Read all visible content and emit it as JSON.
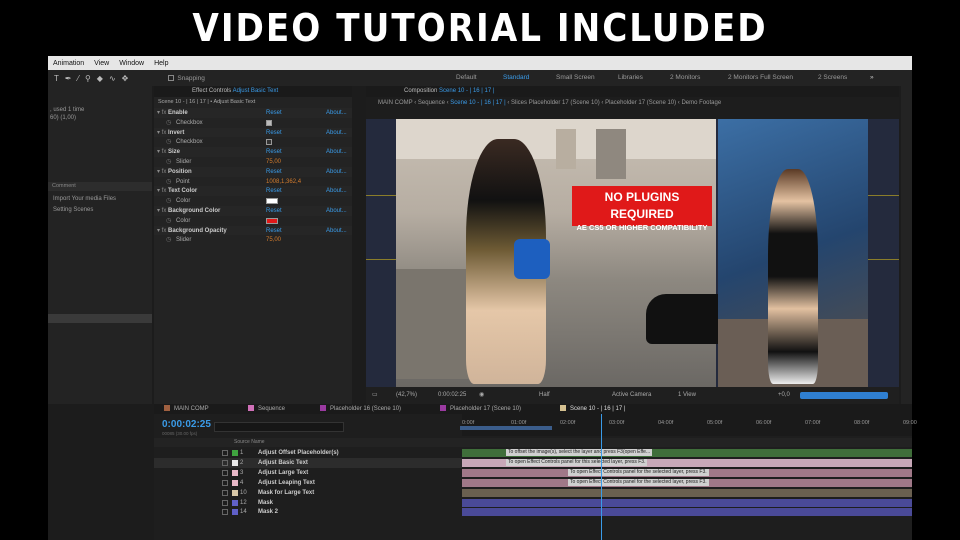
{
  "banner": {
    "title": "VIDEO TUTORIAL INCLUDED"
  },
  "menu": [
    "Animation",
    "View",
    "Window",
    "Help"
  ],
  "toolbar": {
    "snapping": "Snapping",
    "workspaces": [
      "Default",
      "Standard",
      "Small Screen",
      "Libraries",
      "2 Monitors",
      "2 Monitors Full Screen",
      "2 Screens"
    ]
  },
  "project": {
    "info": [
      ", used 1 time",
      "60) (1,00)"
    ],
    "header": "Comment",
    "items": [
      "Import Your media Files",
      "Setting Scenes"
    ]
  },
  "effects": {
    "tab_prefix": "Effect Controls",
    "tab_layer": "Adjust Basic Text",
    "breadcrumb": "Scene 10 - | 16 | 17 | • Adjust Basic Text",
    "rows": [
      {
        "type": "parent",
        "name": "Enable",
        "reset": "Reset",
        "about": "About..."
      },
      {
        "type": "child",
        "name": "Checkbox",
        "checked": true
      },
      {
        "type": "parent",
        "name": "Invert",
        "reset": "Reset",
        "about": "About..."
      },
      {
        "type": "child",
        "name": "Checkbox",
        "checked": false
      },
      {
        "type": "parent",
        "name": "Size",
        "reset": "Reset",
        "about": "About..."
      },
      {
        "type": "child",
        "name": "Slider",
        "value": "75,00"
      },
      {
        "type": "parent",
        "name": "Position",
        "reset": "Reset",
        "about": "About..."
      },
      {
        "type": "child",
        "name": "Point",
        "value": "1008,1,362,4"
      },
      {
        "type": "parent",
        "name": "Text Color",
        "reset": "Reset",
        "about": "About..."
      },
      {
        "type": "child",
        "name": "Color",
        "swatch": "#ffffff"
      },
      {
        "type": "parent",
        "name": "Background Color",
        "reset": "Reset",
        "about": "About..."
      },
      {
        "type": "child",
        "name": "Color",
        "swatch": "#e01818"
      },
      {
        "type": "parent",
        "name": "Background Opacity",
        "reset": "Reset",
        "about": "About..."
      },
      {
        "type": "child",
        "name": "Slider",
        "value": "75,00"
      }
    ]
  },
  "comp": {
    "tab_prefix": "Composition",
    "tab_name": "Scene 10 - | 16 | 17 |",
    "crumbs": [
      "MAIN COMP",
      "Sequence",
      "Scene 10 - | 16 | 17 |",
      "Slices Placeholder 17 (Scene 10)",
      "Placeholder 17 (Scene 10)",
      "Demo Footage"
    ],
    "overlay_title": "NO PLUGINS REQUIRED",
    "overlay_subtitle": "AE CS5 OR HIGHER COMPATIBILITY",
    "controls": {
      "zoom": "(42,7%)",
      "time": "0:00:02:25",
      "resolution": "Half",
      "camera": "Active Camera",
      "view": "1 View",
      "exposure": "+0,0"
    }
  },
  "timeline": {
    "tabs": [
      {
        "label": "MAIN COMP"
      },
      {
        "label": "Sequence"
      },
      {
        "label": "Placeholder 16 (Scene 10)"
      },
      {
        "label": "Placeholder 17 (Scene 10)"
      },
      {
        "label": "Scene 10 - | 16 | 17 |"
      }
    ],
    "current_time": "0:00:02:25",
    "frame_info": "00085 (30.00 fps)",
    "col_source": "Source Name",
    "ruler": [
      "0:00f",
      "01:00f",
      "02:00f",
      "03:00f",
      "04:00f",
      "05:00f",
      "06:00f",
      "07:00f",
      "08:00f",
      "09:00"
    ],
    "layers": [
      {
        "num": "1",
        "name": "Adjust Offset Placeholder(s)",
        "color": "#3fa33f",
        "bar_color": "#3f6e3a",
        "note": "To offset the image(s), select the layer and press F3(open Effe..."
      },
      {
        "num": "2",
        "name": "Adjust Basic Text",
        "color": "#e8e8e8",
        "bar_color": "#c8a8b8",
        "note": "To open Effect Controls panel for this selected layer, press F3."
      },
      {
        "num": "3",
        "name": "Adjust Large Text",
        "color": "#e8b8c8",
        "bar_color": "#a07888",
        "note": "To open Effect Controls panel for the selected layer, press F3."
      },
      {
        "num": "4",
        "name": "Adjust Leaping Text",
        "color": "#e8b8c8",
        "bar_color": "#a07888",
        "note": "To open Effect Controls panel for the selected layer, press F3."
      },
      {
        "num": "10",
        "name": "Mask for Large Text",
        "color": "#d8c8a8",
        "bar_color": "#6a6050",
        "note": ""
      },
      {
        "num": "12",
        "name": "Mask",
        "color": "#6060c8",
        "bar_color": "#4a4a98",
        "note": ""
      },
      {
        "num": "14",
        "name": "Mask 2",
        "color": "#6060c8",
        "bar_color": "#4a4a98",
        "note": ""
      }
    ]
  }
}
